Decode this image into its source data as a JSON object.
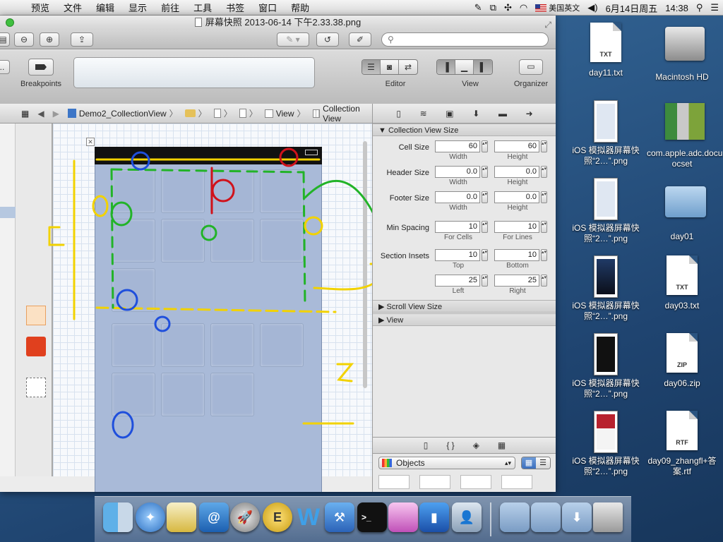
{
  "menubar": {
    "apple": "",
    "items": [
      "预览",
      "文件",
      "编辑",
      "显示",
      "前往",
      "工具",
      "书签",
      "窗口",
      "帮助"
    ],
    "input_method": "美国英文",
    "date": "6月14日周五",
    "time": "14:38"
  },
  "preview": {
    "title": "屏幕快照 2013-06-14 下午2.33.38.png",
    "search_placeholder": ""
  },
  "xcode": {
    "breakpoints_label": "Breakpoints",
    "editor_label": "Editor",
    "view_label": "View",
    "organizer_label": "Organizer",
    "plus": "+",
    "jumpbar": [
      "Demo2_CollectionView",
      "View",
      "Collection View"
    ]
  },
  "inspector": {
    "section_collection": "Collection View Size",
    "cell_size_label": "Cell Size",
    "cell_width": "60",
    "cell_height": "60",
    "width_label": "Width",
    "height_label": "Height",
    "header_size_label": "Header Size",
    "header_width": "0.0",
    "header_height": "0.0",
    "footer_size_label": "Footer Size",
    "footer_width": "0.0",
    "footer_height": "0.0",
    "min_spacing_label": "Min Spacing",
    "min_spacing_cells": "10",
    "min_spacing_lines": "10",
    "for_cells_label": "For Cells",
    "for_lines_label": "For Lines",
    "section_insets_label": "Section Insets",
    "inset_top": "10",
    "inset_bottom": "10",
    "inset_left": "25",
    "inset_right": "25",
    "top_label": "Top",
    "bottom_label": "Bottom",
    "left_label": "Left",
    "right_label": "Right",
    "section_scroll": "Scroll View Size",
    "section_view": "View",
    "objects_label": "Objects"
  },
  "desktop": {
    "icons": [
      {
        "label": "day11.txt",
        "kind": "txt",
        "badge": "TXT"
      },
      {
        "label": "Macintosh HD",
        "kind": "hd",
        "badge": ""
      },
      {
        "label": "iOS 模拟器屏幕快照“2…”.png",
        "kind": "shot",
        "badge": ""
      },
      {
        "label": "com.apple.adc.docu…ocset",
        "kind": "books",
        "badge": ""
      },
      {
        "label": "iOS 模拟器屏幕快照“2…”.png",
        "kind": "shot",
        "badge": ""
      },
      {
        "label": "day01",
        "kind": "folder",
        "badge": ""
      },
      {
        "label": "iOS 模拟器屏幕快照“2…”.png",
        "kind": "shot-img1",
        "badge": ""
      },
      {
        "label": "day03.txt",
        "kind": "txt",
        "badge": "TXT"
      },
      {
        "label": "iOS 模拟器屏幕快照“2…”.png",
        "kind": "shot-dark",
        "badge": ""
      },
      {
        "label": "day06.zip",
        "kind": "zip",
        "badge": "ZIP"
      },
      {
        "label": "iOS 模拟器屏幕快照“2…”.png",
        "kind": "shot-img2",
        "badge": ""
      },
      {
        "label": "day09_zhangfl+答案.rtf",
        "kind": "rtf",
        "badge": "RTF"
      }
    ]
  },
  "colors": {
    "annotation_red": "#d0121b",
    "annotation_green": "#22b328",
    "annotation_blue": "#1f4fdc",
    "annotation_yellow": "#f2d200"
  }
}
